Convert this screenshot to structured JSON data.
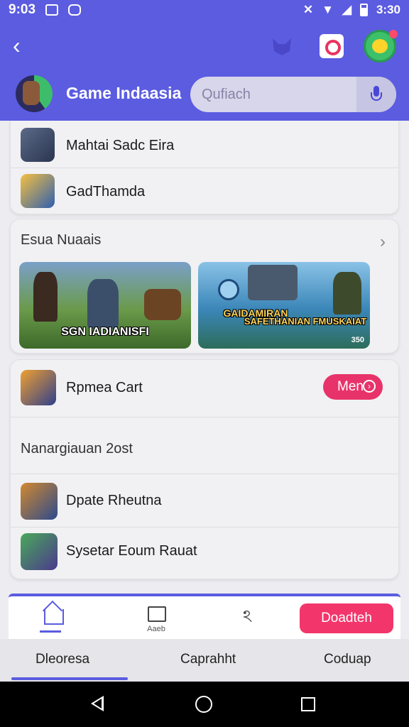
{
  "status_bar": {
    "time": "9:03",
    "right_time": "3:30"
  },
  "header": {
    "app_title": "Game Indaasia",
    "search_placeholder": "Qufiach"
  },
  "top_list": [
    {
      "label": "Mahtai Sadc Eira",
      "icon": "game-icon-knight",
      "color": "#3b4a66"
    },
    {
      "label": "GadThamda",
      "icon": "game-icon-warrior",
      "color": "#e8a23a"
    }
  ],
  "featured": {
    "title": "Esua Nuaais",
    "banners": [
      {
        "title": "SGN IADIANISFI",
        "subtitle": ""
      },
      {
        "title": "GAIDAMIRAN",
        "title2": "SAFETHANIAN FMUSKAIAT",
        "subtitle": "350"
      }
    ]
  },
  "promo": {
    "label": "Rpmea Cart",
    "button": "Men"
  },
  "second_section": {
    "title": "Nanargiauan 2ost",
    "items": [
      {
        "label": "Dpate Rheutna",
        "icon": "game-icon-shield",
        "color": "#c77a2a"
      },
      {
        "label": "Sysetar Eoum Rauat",
        "icon": "game-icon-hero",
        "color": "#3d8a4a"
      }
    ]
  },
  "bottom_tabs": {
    "news_label": "Aaeb",
    "cta_label": "Doadteh"
  },
  "bottom_nav": [
    "Dleoresa",
    "Caprahht",
    "Coduap"
  ]
}
